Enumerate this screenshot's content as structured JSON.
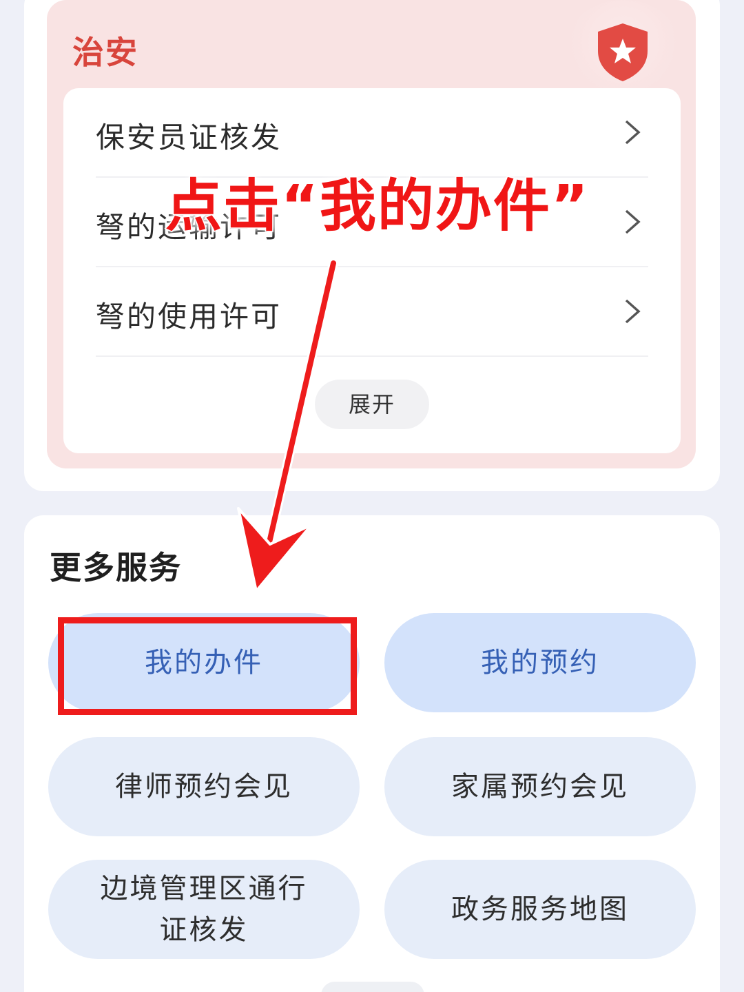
{
  "section": {
    "title": "治安",
    "badge_icon": "shield-star-icon",
    "items": [
      {
        "label": "保安员证核发"
      },
      {
        "label": "弩的运输许可"
      },
      {
        "label": "弩的使用许可"
      }
    ],
    "expand_label": "展开"
  },
  "more_services": {
    "title": "更多服务",
    "buttons": [
      {
        "label": "我的办件"
      },
      {
        "label": "我的预约"
      },
      {
        "label": "律师预约会见"
      },
      {
        "label": "家属预约会见"
      },
      {
        "label": "边境管理区通行\n证核发"
      },
      {
        "label": "政务服务地图"
      }
    ]
  },
  "annotation": {
    "text": "点击“我的办件”",
    "color": "#f01616"
  },
  "colors": {
    "accent_red": "#d8453c",
    "primary_blue": "#3560b5",
    "button_bg": "#e6edf9"
  }
}
